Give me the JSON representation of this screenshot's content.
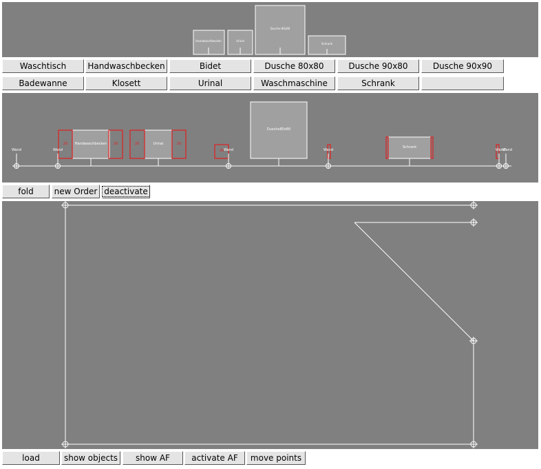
{
  "preview": {
    "items": [
      {
        "label": "Handwaschbecken"
      },
      {
        "label": "Urinal"
      },
      {
        "label": "Dusche 80x80"
      },
      {
        "label": "Schrank"
      }
    ]
  },
  "object_buttons": {
    "row1": [
      "Waschtisch",
      "Handwaschbecken",
      "Bidet",
      "Dusche 80x80",
      "Dusche 90x80",
      "Dusche 90x90"
    ],
    "row2": [
      "Badewanne",
      "Klosett",
      "Urinal",
      "Waschmaschine",
      "Schrank",
      ""
    ]
  },
  "wall_strip": {
    "wall_label": "Wand",
    "gap_label": "20",
    "objects": [
      {
        "label": "Handwaschbecken"
      },
      {
        "label": "Urinal"
      },
      {
        "label": "Dusche80x80"
      },
      {
        "label": "Schrank"
      }
    ]
  },
  "middle_toolbar": {
    "fold": "fold",
    "new_order": "new Order",
    "deactivate": "deactivate"
  },
  "bottom_toolbar": {
    "load": "load",
    "show_objects": "show objects",
    "show_af": "show AF",
    "activate_af": "activate AF",
    "move_points": "move points"
  },
  "colors": {
    "canvas": "#808080",
    "outline": "#ffffff",
    "object_fill": "#a0a0a0",
    "clearance": "#e02020"
  }
}
